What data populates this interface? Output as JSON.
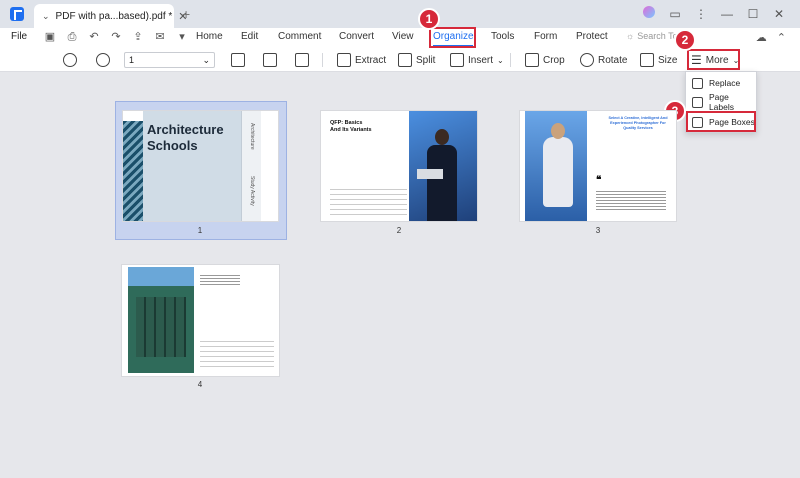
{
  "titlebar": {
    "tab_title": "PDF with pa...based).pdf *",
    "tab_close": "✕",
    "new_tab": "+"
  },
  "menubar": {
    "file": "File",
    "items": [
      "Home",
      "Edit",
      "Comment",
      "Convert",
      "View",
      "Organize",
      "Tools",
      "Form",
      "Protect"
    ],
    "search_placeholder": "Search To"
  },
  "toolbar": {
    "page_value": "1",
    "extract": "Extract",
    "split": "Split",
    "insert": "Insert",
    "crop": "Crop",
    "rotate": "Rotate",
    "size": "Size",
    "more": "More"
  },
  "more_menu": {
    "items": [
      "Replace",
      "Page Labels",
      "Page Boxes"
    ]
  },
  "callouts": [
    "1",
    "2",
    "3"
  ],
  "pages": [
    {
      "number": "1",
      "title_line1": "Architecture",
      "title_line2": "Schools",
      "side_label1": "Architecture",
      "side_label2": "Study Activity"
    },
    {
      "number": "2",
      "title_line1": "QFP: Basics",
      "title_line2": "And Its Variants"
    },
    {
      "number": "3",
      "title_line1": "Select A Creative, Intelligent And",
      "title_line2": "Experienced Photographer For",
      "title_line3": "Quality Services"
    },
    {
      "number": "4"
    }
  ],
  "colors": {
    "accent": "#1f6ff0",
    "callout": "#d6293a",
    "selection": "#c7d3ef",
    "canvas": "#e6e7eb"
  }
}
